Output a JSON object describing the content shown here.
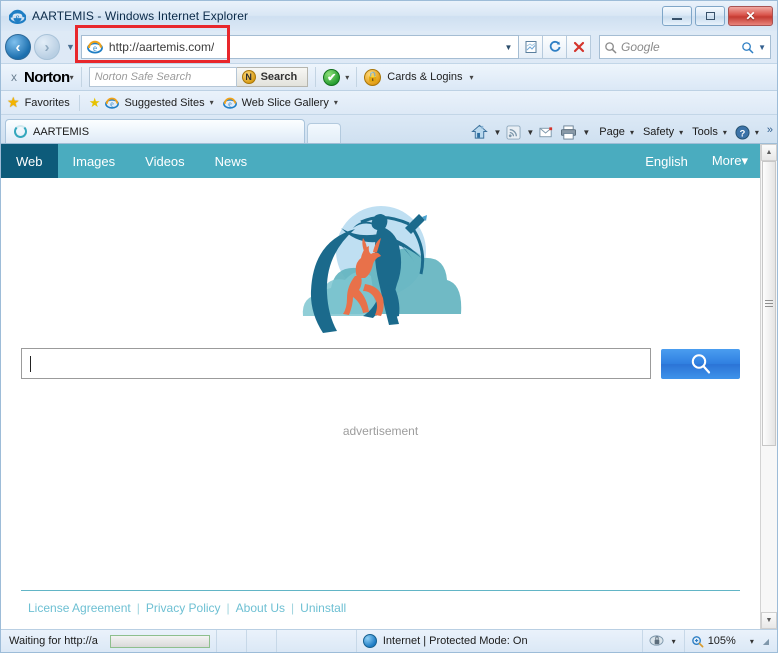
{
  "window": {
    "title": "AARTEMIS - Windows Internet Explorer",
    "minimize_label": "Minimize",
    "maximize_label": "Maximize",
    "close_label": "Close"
  },
  "navigation": {
    "back_label": "Back",
    "forward_label": "Forward",
    "history_label": "Recent Pages",
    "url": "http://aartemis.com/",
    "url_dropdown_label": "Address dropdown",
    "compatibility_label": "Compatibility View",
    "refresh_label": "Refresh",
    "stop_label": "Stop",
    "search_placeholder": "Google",
    "search_value": "",
    "search_dropdown_label": "Search provider dropdown"
  },
  "norton": {
    "close_label": "x",
    "brand": "Norton",
    "brand_caret": "▾",
    "search_placeholder": "Norton Safe Search",
    "search_value": "",
    "search_button": "Search",
    "search_button_icon": "N",
    "status_caret": "▾",
    "cards_logins": "Cards & Logins",
    "cards_caret": "▾"
  },
  "favorites_bar": {
    "favorites": "Favorites",
    "items": [
      {
        "label": "Suggested Sites",
        "caret": "▾"
      },
      {
        "label": "Web Slice Gallery",
        "caret": "▾"
      }
    ]
  },
  "tabs": {
    "items": [
      {
        "title": "AARTEMIS"
      }
    ],
    "new_tab_label": "New Tab"
  },
  "command_bar": {
    "home_label": "Home",
    "feeds_label": "Feeds",
    "mail_label": "Read Mail",
    "print_label": "Print",
    "menus": [
      {
        "label": "Page",
        "caret": "▾"
      },
      {
        "label": "Safety",
        "caret": "▾"
      },
      {
        "label": "Tools",
        "caret": "▾"
      }
    ],
    "help_caret": "▾",
    "overflow": "»"
  },
  "site": {
    "nav": {
      "tabs": [
        {
          "label": "Web",
          "active": true
        },
        {
          "label": "Images",
          "active": false
        },
        {
          "label": "Videos",
          "active": false
        },
        {
          "label": "News",
          "active": false
        }
      ],
      "language": "English",
      "more": "More▾"
    },
    "logo_alt": "AARTEMIS archer and deer logo",
    "search": {
      "value": "",
      "placeholder": "",
      "button_label": "Search"
    },
    "advertisement_label": "advertisement",
    "footer": {
      "links": [
        {
          "label": "License Agreement"
        },
        {
          "label": "Privacy Policy"
        },
        {
          "label": "About Us"
        },
        {
          "label": "Uninstall"
        }
      ],
      "separator": "|"
    }
  },
  "scrollbar": {
    "up_arrow": "▲",
    "down_arrow": "▼"
  },
  "status_bar": {
    "message": "Waiting for http://a",
    "zone": "Internet | Protected Mode: On",
    "zone_caret": "▾",
    "zoom": "105%",
    "zoom_caret": "▾"
  },
  "colors": {
    "site_nav": "#4aacbf",
    "site_nav_active": "#0d5b7a",
    "footer_link": "#6ec0d3",
    "search_button": "#2f7fe0",
    "annotation": "#e8272c"
  }
}
